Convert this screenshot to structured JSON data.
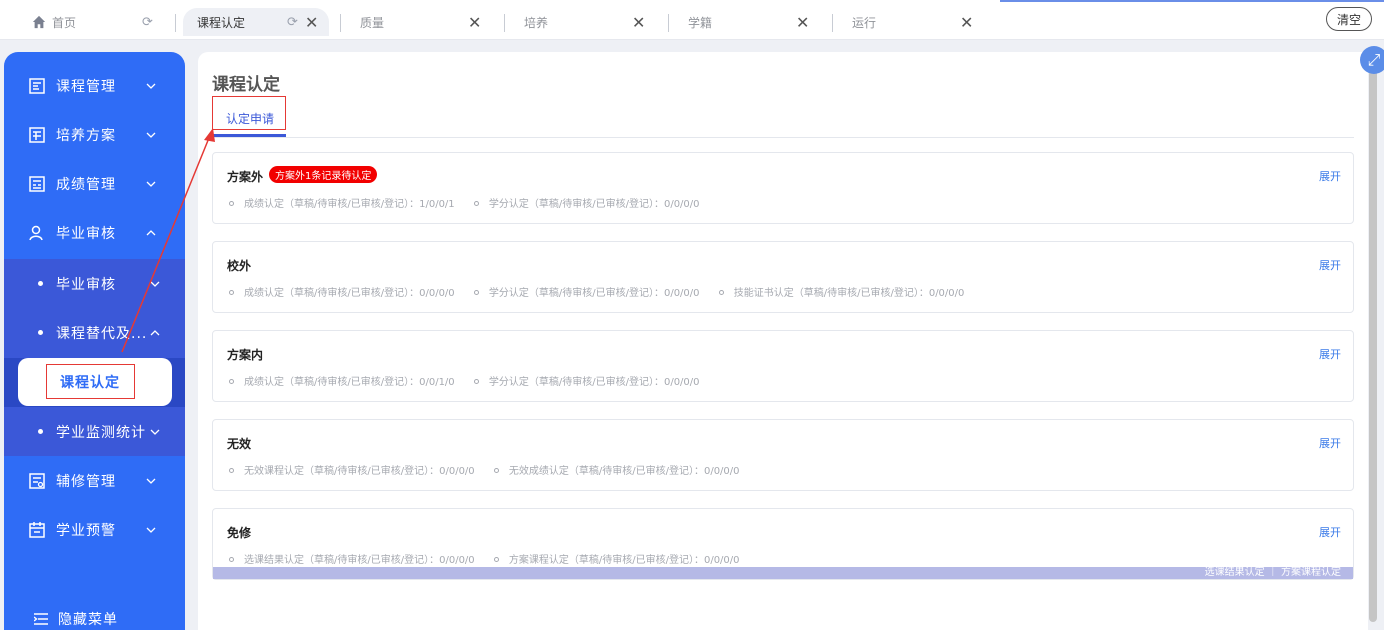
{
  "tabs": [
    {
      "label": "首页",
      "active": false
    },
    {
      "label": "课程认定",
      "active": true
    },
    {
      "label": "质量",
      "active": false
    },
    {
      "label": "培养",
      "active": false
    },
    {
      "label": "学籍",
      "active": false
    },
    {
      "label": "运行",
      "active": false
    }
  ],
  "clear_label": "清空",
  "sidebar": {
    "items": [
      {
        "label": "课程管理",
        "icon": "document-icon"
      },
      {
        "label": "培养方案",
        "icon": "plan-icon"
      },
      {
        "label": "成绩管理",
        "icon": "grade-icon"
      },
      {
        "label": "毕业审核",
        "icon": "user-icon"
      },
      {
        "label": "辅修管理",
        "icon": "minor-icon"
      },
      {
        "label": "学业预警",
        "icon": "calendar-icon"
      }
    ],
    "sub_items": [
      {
        "label": "毕业审核"
      },
      {
        "label": "课程替代及..."
      },
      {
        "label": "学业监测统计"
      }
    ],
    "active_item": "课程认定",
    "hide_menu_label": "隐藏菜单"
  },
  "main": {
    "title": "课程认定",
    "subtab": "认定申请",
    "expand_label": "展开",
    "cards": [
      {
        "title": "方案外",
        "badge": "方案外1条记录待认定",
        "stats": [
          "成绩认定（草稿/待审核/已审核/登记）：1/0/0/1",
          "学分认定（草稿/待审核/已审核/登记）：0/0/0/0"
        ]
      },
      {
        "title": "校外",
        "stats": [
          "成绩认定（草稿/待审核/已审核/登记）：0/0/0/0",
          "学分认定（草稿/待审核/已审核/登记）：0/0/0/0",
          "技能证书认定（草稿/待审核/已审核/登记）：0/0/0/0"
        ]
      },
      {
        "title": "方案内",
        "stats": [
          "成绩认定（草稿/待审核/已审核/登记）：0/0/1/0",
          "学分认定（草稿/待审核/已审核/登记）：0/0/0/0"
        ]
      },
      {
        "title": "无效",
        "stats": [
          "无效课程认定（草稿/待审核/已审核/登记）：0/0/0/0",
          "无效成绩认定（草稿/待审核/已审核/登记）：0/0/0/0"
        ]
      },
      {
        "title": "免修",
        "stats": [
          "选课结果认定（草稿/待审核/已审核/登记）：0/0/0/0",
          "方案课程认定（草稿/待审核/已审核/登记）：0/0/0/0"
        ],
        "footer": "选课结果认定 ｜ 方案课程认定"
      }
    ]
  },
  "colors": {
    "sidebar": "#2f6cf6",
    "accent": "#3b58d8",
    "badge": "#f20000",
    "annotation": "#e53935"
  }
}
